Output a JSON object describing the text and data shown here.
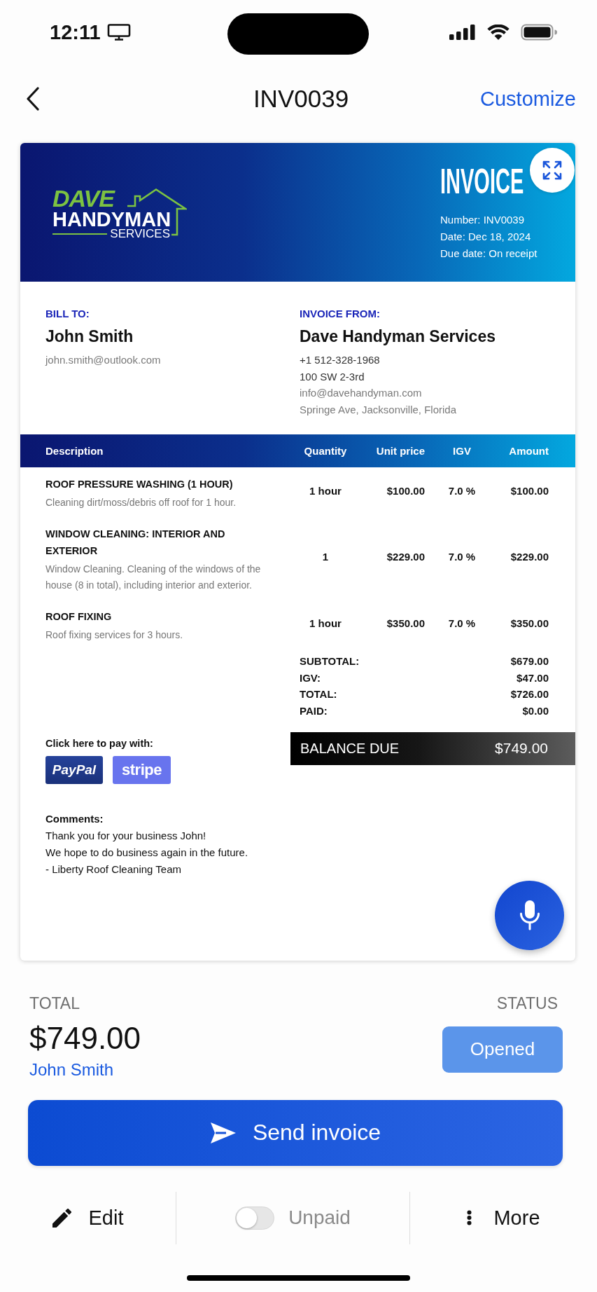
{
  "status_bar": {
    "time": "12:11"
  },
  "nav": {
    "title": "INV0039",
    "action": "Customize"
  },
  "invoice": {
    "header": {
      "logo": [
        "DAVE",
        "HANDYMAN",
        "SERVICES"
      ],
      "title": "INVOICE",
      "meta": [
        "Number: INV0039",
        "Date: Dec 18, 2024",
        "Due date: On receipt"
      ]
    },
    "parties": [
      {
        "label": "BILL TO:",
        "name": "John Smith",
        "lines": [
          {
            "text": "john.smith@outlook.com",
            "muted": true
          }
        ]
      },
      {
        "label": "INVOICE FROM:",
        "name": "Dave Handyman Services",
        "lines": [
          {
            "text": "+1 512-328-1968",
            "muted": false
          },
          {
            "text": "100 SW 2-3rd",
            "muted": false
          },
          {
            "text": "info@davehandyman.com",
            "muted": true
          },
          {
            "text": "Springe Ave, Jacksonville, Florida",
            "muted": true
          }
        ]
      }
    ],
    "table": {
      "columns": [
        "Description",
        "Quantity",
        "Unit price",
        "IGV",
        "Amount"
      ],
      "rows": [
        {
          "title": "ROOF PRESSURE WASHING (1 HOUR)",
          "description": "Cleaning dirt/moss/debris off roof for 1 hour.",
          "quantity": "1 hour",
          "unit_price": "$100.00",
          "igv": "7.0 %",
          "amount": "$100.00"
        },
        {
          "title": "WINDOW CLEANING: INTERIOR AND EXTERIOR",
          "description": "Window Cleaning. Cleaning of the windows of the house (8 in total), including interior and exterior.",
          "quantity": "1",
          "unit_price": "$229.00",
          "igv": "7.0 %",
          "amount": "$229.00"
        },
        {
          "title": "ROOF FIXING",
          "description": "Roof fixing services for 3 hours.",
          "quantity": "1 hour",
          "unit_price": "$350.00",
          "igv": "7.0 %",
          "amount": "$350.00"
        }
      ]
    },
    "totals": [
      {
        "label": "SUBTOTAL:",
        "value": "$679.00"
      },
      {
        "label": "IGV:",
        "value": "$47.00"
      },
      {
        "label": "TOTAL:",
        "value": "$726.00"
      },
      {
        "label": "PAID:",
        "value": "$0.00"
      }
    ],
    "balance_due": {
      "label": "BALANCE DUE",
      "value": "$749.00"
    },
    "payment": {
      "label": "Click here to pay with:",
      "methods": [
        {
          "kind": "paypal",
          "label": "PayPal"
        },
        {
          "kind": "stripe",
          "label": "stripe"
        }
      ]
    },
    "comments": {
      "label": "Comments:",
      "lines": [
        "Thank you for your business John!",
        "We hope to do business again in the future.",
        "- Liberty Roof Cleaning Team"
      ]
    }
  },
  "summary": {
    "total_label": "TOTAL",
    "total": "$749.00",
    "customer": "John Smith",
    "status_label": "STATUS",
    "status": "Opened"
  },
  "send_button": {
    "label": "Send invoice"
  },
  "toolbar": [
    {
      "kind": "edit",
      "label": "Edit"
    },
    {
      "kind": "toggle",
      "label": "Unpaid",
      "on": false
    },
    {
      "kind": "more",
      "label": "More"
    }
  ]
}
